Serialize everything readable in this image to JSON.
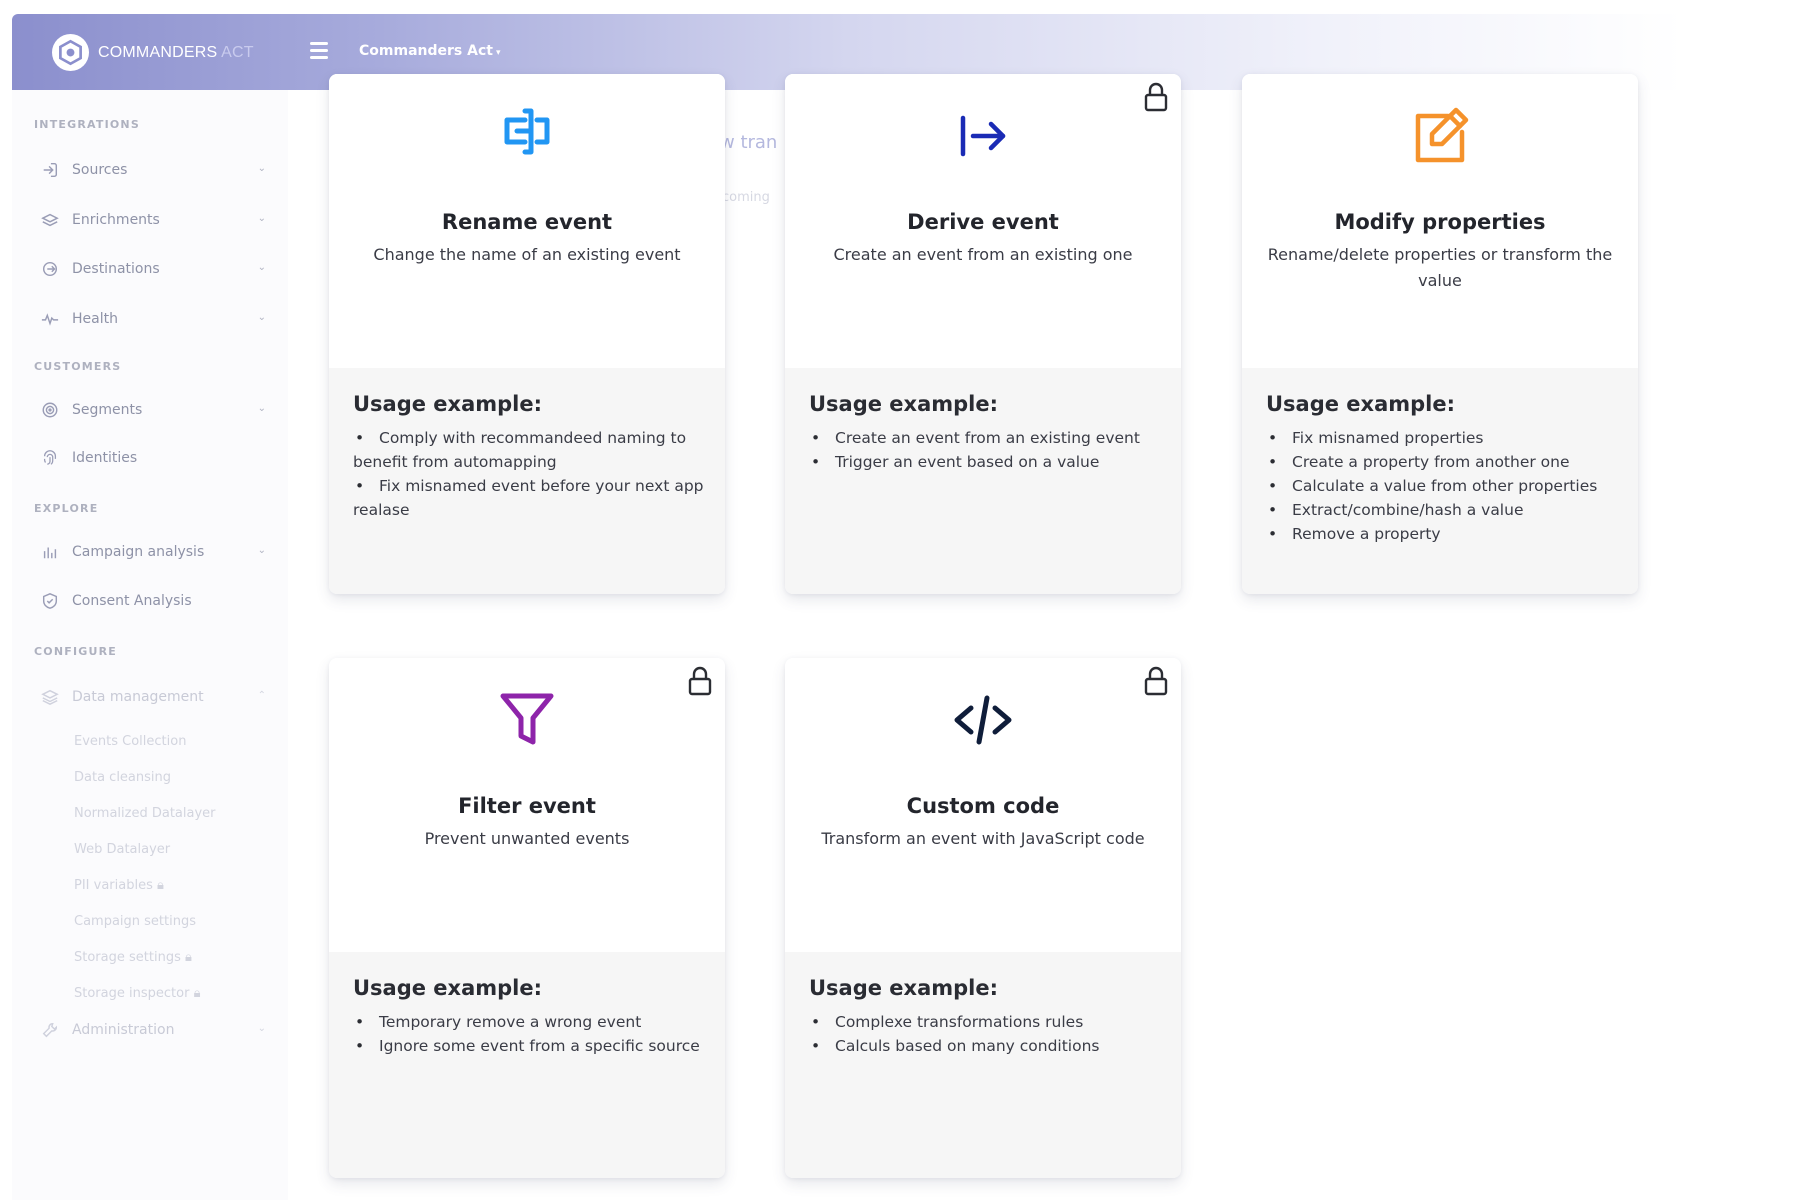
{
  "app": {
    "logo_text_main": "COMMANDERS",
    "logo_text_accent": "ACT",
    "account_label": "Commanders Act"
  },
  "sidebar": {
    "sections": {
      "integrations": "INTEGRATIONS",
      "customers": "CUSTOMERS",
      "explore": "EXPLORE",
      "configure": "CONFIGURE"
    },
    "items": {
      "sources": "Sources",
      "enrichments": "Enrichments",
      "destinations": "Destinations",
      "health": "Health",
      "segments": "Segments",
      "identities": "Identities",
      "campaign_analysis": "Campaign analysis",
      "consent_analysis": "Consent Analysis",
      "data_management": "Data management",
      "administration": "Administration"
    },
    "sub_items": {
      "events_collection": "Events Collection",
      "data_cleansing": "Data cleansing",
      "normalized_datalayer": "Normalized Datalayer",
      "web_datalayer": "Web Datalayer",
      "pii_variables": "PII variables",
      "campaign_settings": "Campaign settings",
      "storage_settings": "Storage settings",
      "storage_inspector": "Storage inspector"
    }
  },
  "background": {
    "ghost_heading": "w tran",
    "ghost_sub": "coming"
  },
  "cards": {
    "rename": {
      "title": "Rename event",
      "description": "Change the name of an existing event",
      "usage_title": "Usage example:",
      "usage": [
        "Comply with recommandeed naming to benefit from automapping",
        "Fix misnamed event before your next app realase"
      ],
      "icon": "rename-icon",
      "color": "#2196f3"
    },
    "derive": {
      "title": "Derive event",
      "description": "Create an event from an existing one",
      "usage_title": "Usage example:",
      "usage": [
        "Create an event from an existing event",
        "Trigger an event based on a value"
      ],
      "icon": "arrow-right-to-line-icon",
      "color": "#1a2bb5",
      "locked": true
    },
    "modify": {
      "title": "Modify properties",
      "description": "Rename/delete properties or transform the value",
      "usage_title": "Usage example:",
      "usage": [
        "Fix misnamed properties",
        "Create a property from another one",
        "Calculate a value from other properties",
        "Extract/combine/hash a value",
        "Remove a property"
      ],
      "icon": "edit-icon",
      "color": "#f5922b"
    },
    "filter": {
      "title": "Filter event",
      "description": "Prevent unwanted events",
      "usage_title": "Usage example:",
      "usage": [
        "Temporary remove a wrong event",
        "Ignore some event from a specific source"
      ],
      "icon": "funnel-icon",
      "color": "#8e24aa",
      "locked": true
    },
    "custom": {
      "title": "Custom code",
      "description": "Transform an event with JavaScript code",
      "usage_title": "Usage example:",
      "usage": [
        "Complexe transformations rules",
        "Calculs based on many conditions"
      ],
      "icon": "code-icon",
      "color": "#0f1d3a",
      "locked": true
    }
  }
}
